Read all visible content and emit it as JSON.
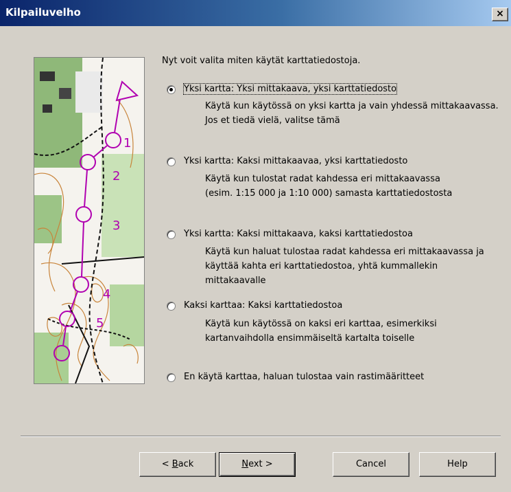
{
  "window": {
    "title": "Kilpailuvelho",
    "close_symbol": "×"
  },
  "intro": "Nyt voit valita miten käytät karttatiedostoja.",
  "options": [
    {
      "label": "Yksi kartta: Yksi mittakaava, yksi karttatiedosto",
      "selected": true,
      "description": "Käytä kun käytössä on yksi kartta ja vain yhdessä mittakaavassa. Jos et tiedä vielä, valitse tämä"
    },
    {
      "label": "Yksi kartta: Kaksi mittakaavaa, yksi karttatiedosto",
      "selected": false,
      "description": "Käytä kun tulostat radat kahdessa eri mittakaavassa (esim. 1:15 000 ja 1:10 000) samasta karttatiedostosta"
    },
    {
      "label": "Yksi kartta: Kaksi mittakaava, kaksi karttatiedostoa",
      "selected": false,
      "description": "Käytä kun haluat tulostaa radat kahdessa eri mittakaavassa ja käyttää kahta eri karttatiedostoa, yhtä kummallekin mittakaavalle"
    },
    {
      "label": "Kaksi karttaa: Kaksi karttatiedostoa",
      "selected": false,
      "description": "Käytä kun käytössä on kaksi eri karttaa, esimerkiksi kartanvaihdolla ensimmäiseltä kartalta toiselle"
    },
    {
      "label": "En käytä karttaa, haluan tulostaa vain rastimääritteet",
      "selected": false,
      "description": ""
    }
  ],
  "map": {
    "control_numbers": [
      "1",
      "2",
      "3",
      "4",
      "5"
    ]
  },
  "buttons": {
    "back": {
      "prefix": "< ",
      "accel": "B",
      "rest": "ack"
    },
    "next": {
      "accel": "N",
      "rest": "ext >"
    },
    "cancel": "Cancel",
    "help": "Help"
  }
}
